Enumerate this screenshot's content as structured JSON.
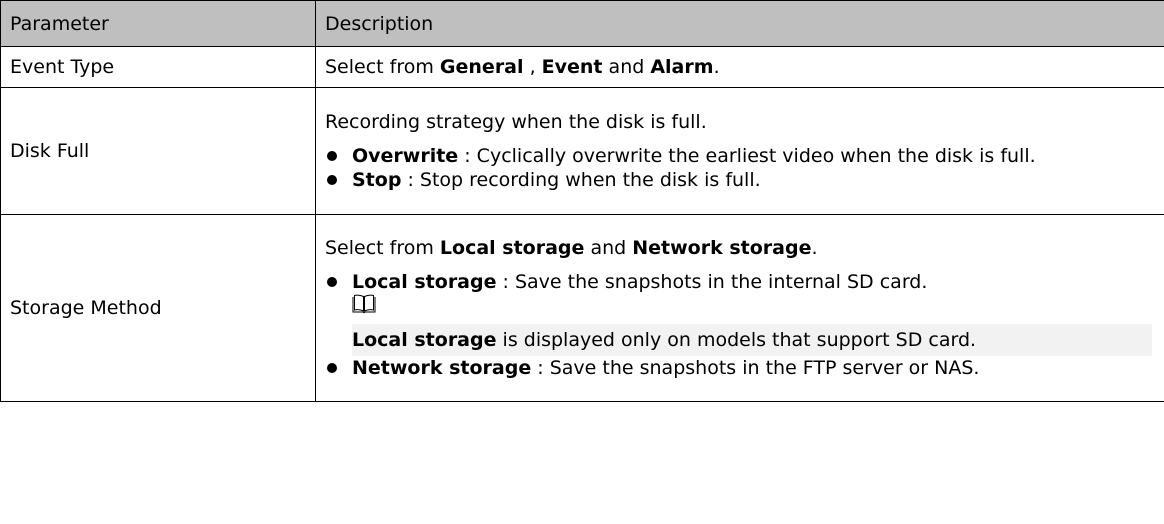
{
  "header": {
    "param": "Parameter",
    "desc": "Description"
  },
  "rows": {
    "event_type": {
      "param": "Event Type",
      "t1": "Select from ",
      "b1": "General",
      "t2": " , ",
      "b2": "Event",
      "t3": " and ",
      "b3": "Alarm",
      "t4": "."
    },
    "disk_full": {
      "param": "Disk Full",
      "intro": "Recording strategy when the disk is full.",
      "items": [
        {
          "term": "Overwrite",
          "text": " : Cyclically overwrite the earliest video when the disk is full."
        },
        {
          "term": "Stop",
          "text": " : Stop recording when the disk is full."
        }
      ]
    },
    "storage_method": {
      "param": "Storage Method",
      "t1": "Select from ",
      "b1": "Local storage",
      "t2": "  and ",
      "b2": "Network storage",
      "t3": ".",
      "items": [
        {
          "term": "Local storage",
          "text": " : Save the snapshots in the internal SD card."
        },
        {
          "term": "Network storage",
          "text": " : Save the snapshots in the FTP server or NAS."
        }
      ],
      "note": {
        "term": "Local storage",
        "text": "  is displayed only on models that support SD card."
      }
    }
  },
  "icons": {
    "note_icon": "open-book-icon"
  }
}
